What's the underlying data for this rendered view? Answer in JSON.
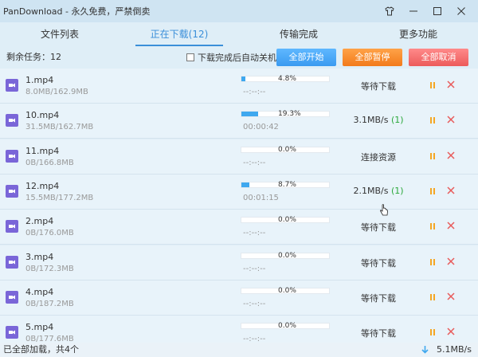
{
  "window": {
    "title": "PanDownload - 永久免费，严禁倒卖"
  },
  "tabs": [
    {
      "label": "文件列表",
      "active": false
    },
    {
      "label": "正在下载(12)",
      "active": true
    },
    {
      "label": "传输完成",
      "active": false
    },
    {
      "label": "更多功能",
      "active": false
    }
  ],
  "toolbar": {
    "remaining": "剩余任务：12",
    "shutdown_label": "下载完成后自动关机",
    "start_all": "全部开始",
    "pause_all": "全部暂停",
    "cancel_all": "全部取消"
  },
  "downloads": [
    {
      "name": "1.mp4",
      "size": "8.0MB/162.9MB",
      "percent_text": "4.8%",
      "progress": 4.8,
      "time": "--:--:--",
      "status": "等待下载",
      "conn": ""
    },
    {
      "name": "10.mp4",
      "size": "31.5MB/162.7MB",
      "percent_text": "19.3%",
      "progress": 19.3,
      "time": "00:00:42",
      "status": "3.1MB/s",
      "conn": "(1)"
    },
    {
      "name": "11.mp4",
      "size": "0B/166.8MB",
      "percent_text": "0.0%",
      "progress": 0,
      "time": "--:--:--",
      "status": "连接资源",
      "conn": ""
    },
    {
      "name": "12.mp4",
      "size": "15.5MB/177.2MB",
      "percent_text": "8.7%",
      "progress": 8.7,
      "time": "00:01:15",
      "status": "2.1MB/s",
      "conn": "(1)"
    },
    {
      "name": "2.mp4",
      "size": "0B/176.0MB",
      "percent_text": "0.0%",
      "progress": 0,
      "time": "--:--:--",
      "status": "等待下载",
      "conn": ""
    },
    {
      "name": "3.mp4",
      "size": "0B/172.3MB",
      "percent_text": "0.0%",
      "progress": 0,
      "time": "--:--:--",
      "status": "等待下载",
      "conn": ""
    },
    {
      "name": "4.mp4",
      "size": "0B/187.2MB",
      "percent_text": "0.0%",
      "progress": 0,
      "time": "--:--:--",
      "status": "等待下载",
      "conn": ""
    },
    {
      "name": "5.mp4",
      "size": "0B/177.6MB",
      "percent_text": "0.0%",
      "progress": 0,
      "time": "--:--:--",
      "status": "等待下载",
      "conn": ""
    }
  ],
  "statusbar": {
    "left": "已全部加载，共4个",
    "speed": "5.1MB/s"
  },
  "icons": {
    "file": "video-file-icon",
    "pause": "pause-icon",
    "close": "close-icon"
  },
  "colors": {
    "accent": "#3b8fd9",
    "progress": "#3fa8ef",
    "file_icon": "#7a66d8",
    "pause": "#f5a623",
    "close": "#e85a5a",
    "conn": "#2aa83a"
  }
}
